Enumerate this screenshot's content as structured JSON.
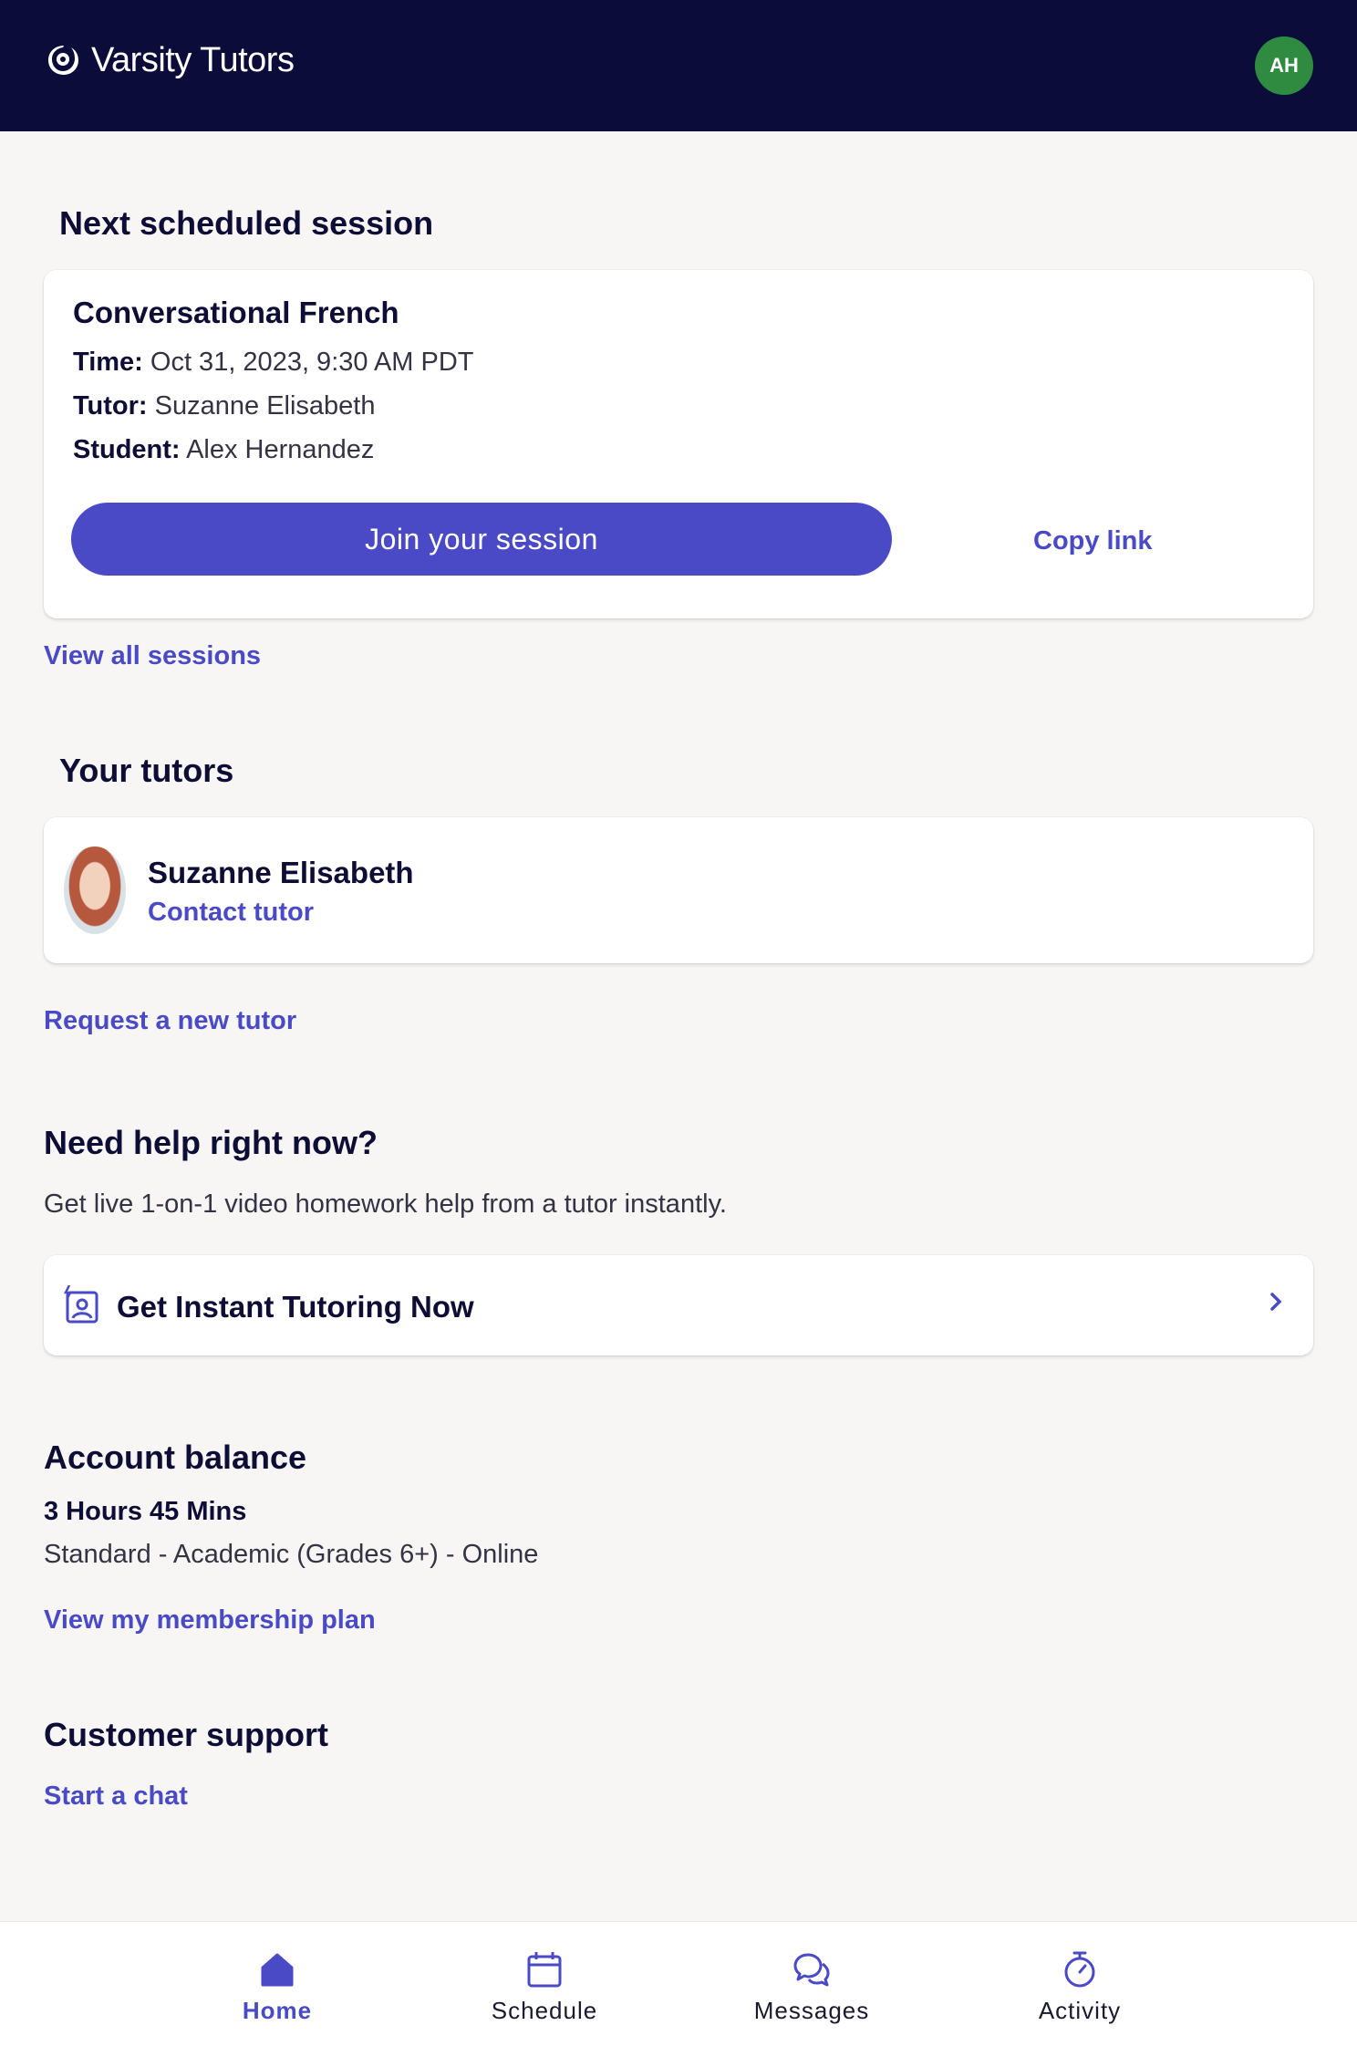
{
  "header": {
    "brand": "Varsity Tutors",
    "avatar_initials": "AH"
  },
  "next_session": {
    "heading": "Next scheduled session",
    "title": "Conversational French",
    "time_label": "Time:",
    "time_value": "Oct 31, 2023, 9:30 AM PDT",
    "tutor_label": "Tutor:",
    "tutor_value": "Suzanne Elisabeth",
    "student_label": "Student:",
    "student_value": "Alex Hernandez",
    "join_label": "Join your session",
    "copy_label": "Copy link",
    "view_all_label": "View all sessions"
  },
  "tutors": {
    "heading": "Your tutors",
    "items": [
      {
        "name": "Suzanne Elisabeth",
        "contact_label": "Contact tutor"
      }
    ],
    "request_label": "Request a new tutor"
  },
  "help": {
    "heading": "Need help right now?",
    "description": "Get live 1-on-1 video homework help from a tutor instantly.",
    "cta_label": "Get Instant Tutoring Now"
  },
  "balance": {
    "heading": "Account balance",
    "amount": "3 Hours 45 Mins",
    "plan": "Standard - Academic (Grades 6+) - Online",
    "plan_link": "View my membership plan"
  },
  "support": {
    "heading": "Customer support",
    "chat_label": "Start a chat"
  },
  "bottom_nav": {
    "items": [
      {
        "label": "Home",
        "icon": "home-icon",
        "active": true
      },
      {
        "label": "Schedule",
        "icon": "calendar-icon",
        "active": false
      },
      {
        "label": "Messages",
        "icon": "chat-bubbles-icon",
        "active": false
      },
      {
        "label": "Activity",
        "icon": "stopwatch-icon",
        "active": false
      }
    ]
  },
  "colors": {
    "header_bg": "#0c0c3a",
    "accent": "#4a4ac6",
    "avatar_bg": "#2e8b3f",
    "page_bg": "#f7f6f4"
  }
}
